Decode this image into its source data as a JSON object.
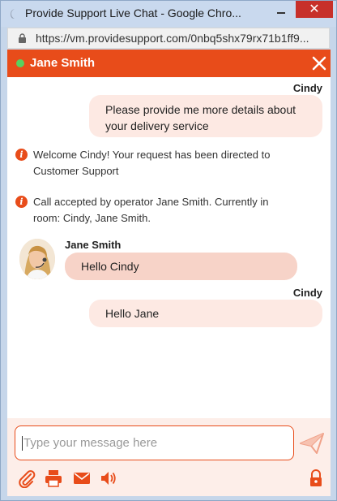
{
  "window": {
    "title": "Provide Support Live Chat - Google Chro...",
    "close_glyph": "✕"
  },
  "address": {
    "url": "https://vm.providesupport.com/0nbq5shx79rx71b1ff9..."
  },
  "chat": {
    "agent_name": "Jane Smith",
    "agent_status_color": "#58d15e",
    "accent_color": "#e84c1a"
  },
  "messages": {
    "cust1_sender": "Cindy",
    "cust1_text_line1": "Please provide me more details about",
    "cust1_text_line2": "your delivery service",
    "sys1_line1": "Welcome Cindy! Your request has been directed to",
    "sys1_line2": "Customer Support",
    "sys2_line1": "Call accepted by operator Jane Smith. Currently in",
    "sys2_line2": "room: Cindy, Jane Smith.",
    "agent_sender": "Jane Smith",
    "agent_text": "Hello Cindy",
    "cust2_sender": "Cindy",
    "cust2_text": "Hello Jane"
  },
  "composer": {
    "placeholder": "Type your message here"
  },
  "toolbar_icons": [
    "paperclip-icon",
    "printer-icon",
    "envelope-icon",
    "speaker-icon",
    "lock-icon",
    "send-icon"
  ]
}
